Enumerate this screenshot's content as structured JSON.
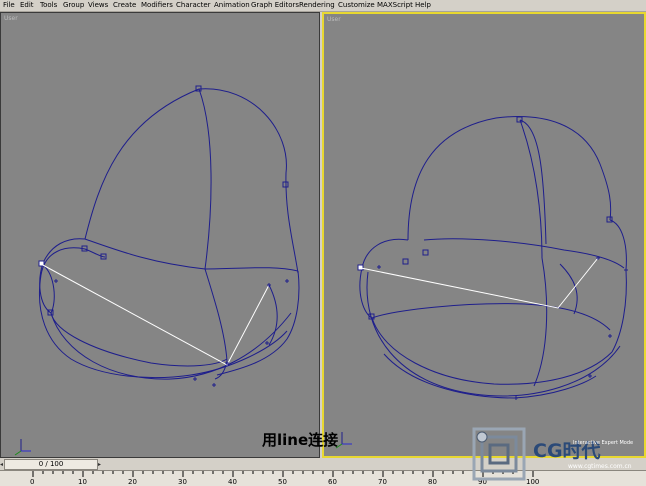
{
  "menu": [
    "File",
    "Edit",
    "Tools",
    "Group",
    "Views",
    "Create",
    "Modifiers",
    "Character",
    "Animation",
    "Graph Editors",
    "Rendering",
    "Customize",
    "MAXScript",
    "Help"
  ],
  "viewports": {
    "left_label": "User",
    "right_label": "User"
  },
  "timeline": {
    "frame_counter": "0 / 100",
    "ticks": [
      "0",
      "10",
      "20",
      "30",
      "40",
      "50",
      "60",
      "70",
      "80",
      "90",
      "100"
    ]
  },
  "caption": "用line连接",
  "watermark": {
    "brand": "CG时代",
    "url": "www.cgtimes.com.cn",
    "side_text": "Interactive Expert Mode"
  },
  "colors": {
    "spline": "#1e1e8c",
    "connector": "#ffffff",
    "active_border": "#e8d830"
  },
  "icons": {
    "axis": "axis-tripod-icon",
    "logo": "cg-logo-icon"
  }
}
